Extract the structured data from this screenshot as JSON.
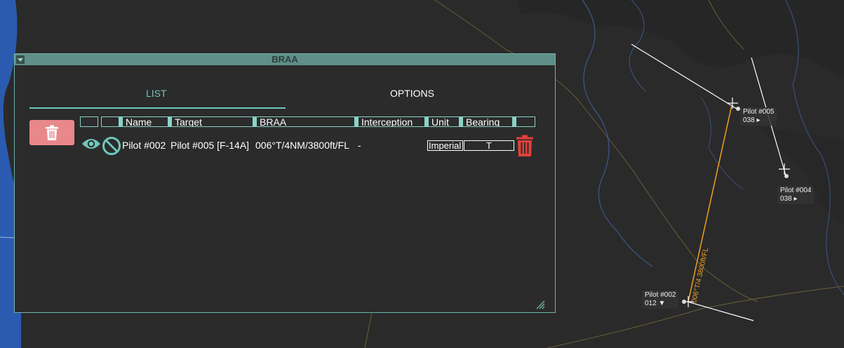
{
  "window": {
    "title": "BRAA",
    "tabs": {
      "list": "LIST",
      "options": "OPTIONS"
    }
  },
  "table": {
    "headers": [
      "",
      "",
      "Name",
      "Target",
      "BRAA",
      "Interception",
      "Unit",
      "Bearing",
      ""
    ],
    "rows": [
      {
        "name": "Pilot #002",
        "target": "Pilot #005 [F-14A]",
        "braa": "006°T/4NM/3800ft/FL",
        "interception": "-",
        "unit": "Imperial",
        "bearing": "T"
      }
    ]
  },
  "map": {
    "labels": [
      {
        "name": "Pilot #005",
        "value": "038 ▸"
      },
      {
        "name": "Pilot #004",
        "value": "038 ▸"
      },
      {
        "name": "Pilot #002",
        "value": "012 ▼"
      }
    ],
    "braa_line_label": "006°T/4 3800ft/FL"
  },
  "colors": {
    "accent": "#6fc7bb",
    "titlebar": "#5f8f88",
    "delete_red": "#e0413a",
    "clear_button": "#e8888a",
    "braa_line": "#f0a020",
    "water": "#2b5bb0"
  }
}
